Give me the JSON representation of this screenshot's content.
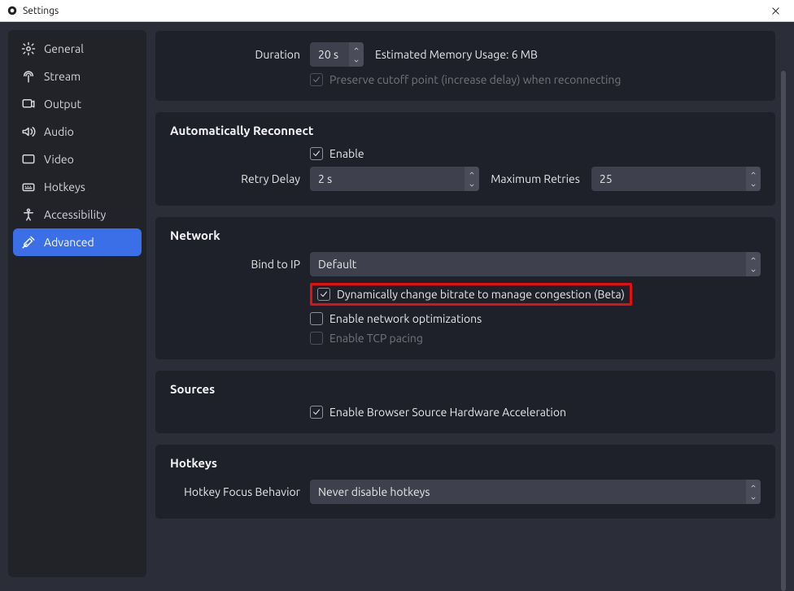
{
  "window": {
    "title": "Settings"
  },
  "sidebar": {
    "items": [
      {
        "label": "General"
      },
      {
        "label": "Stream"
      },
      {
        "label": "Output"
      },
      {
        "label": "Audio"
      },
      {
        "label": "Video"
      },
      {
        "label": "Hotkeys"
      },
      {
        "label": "Accessibility"
      },
      {
        "label": "Advanced"
      }
    ]
  },
  "sections": {
    "stream_delay": {
      "duration_label": "Duration",
      "duration_value": "20 s",
      "memory_usage": "Estimated Memory Usage: 6 MB",
      "preserve_cutoff_label": "Preserve cutoff point (increase delay) when reconnecting"
    },
    "auto_reconnect": {
      "title": "Automatically Reconnect",
      "enable_label": "Enable",
      "retry_delay_label": "Retry Delay",
      "retry_delay_value": "2 s",
      "max_retries_label": "Maximum Retries",
      "max_retries_value": "25"
    },
    "network": {
      "title": "Network",
      "bind_ip_label": "Bind to IP",
      "bind_ip_value": "Default",
      "dyn_bitrate_label": "Dynamically change bitrate to manage congestion (Beta)",
      "net_opt_label": "Enable network optimizations",
      "tcp_pacing_label": "Enable TCP pacing"
    },
    "sources": {
      "title": "Sources",
      "browser_hw_label": "Enable Browser Source Hardware Acceleration"
    },
    "hotkeys": {
      "title": "Hotkeys",
      "focus_label": "Hotkey Focus Behavior",
      "focus_value": "Never disable hotkeys"
    }
  }
}
